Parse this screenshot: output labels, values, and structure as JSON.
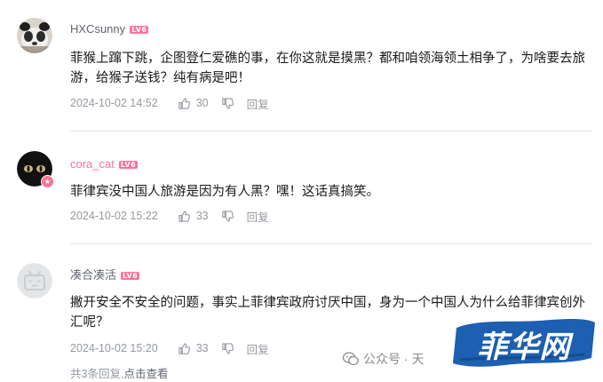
{
  "comments": [
    {
      "username": "HXCsunny",
      "username_color": "#61666d",
      "level": "LV6",
      "text": "菲猴上蹿下跳，企图登仁爱礁的事，在你这就是摸黑？都和咱领海领土相争了，为啥要去旅游，给猴子送钱？纯有病是吧！",
      "time": "2024-10-02 14:52",
      "likes": "30",
      "reply_label": "回复"
    },
    {
      "username": "cora_cat",
      "username_color": "#fb7299",
      "level": "LV6",
      "text": "菲律宾没中国人旅游是因为有人黑？嘿！这话真搞笑。",
      "time": "2024-10-02 15:22",
      "likes": "33",
      "reply_label": "回复"
    },
    {
      "username": "凑合凑活",
      "username_color": "#61666d",
      "level": "LV6",
      "text": "撇开安全不安全的问题，事实上菲律宾政府讨厌中国，身为一个中国人为什么给菲律宾创外汇呢？",
      "time": "2024-10-02 15:20",
      "likes": "33",
      "reply_label": "回复"
    }
  ],
  "footer": {
    "count_text": "共3条回复,",
    "more_text": "点击查看"
  },
  "watermark": {
    "text": "公众号 · 天"
  },
  "logo": {
    "text": "菲华网",
    "color": "#1d5fb0"
  }
}
